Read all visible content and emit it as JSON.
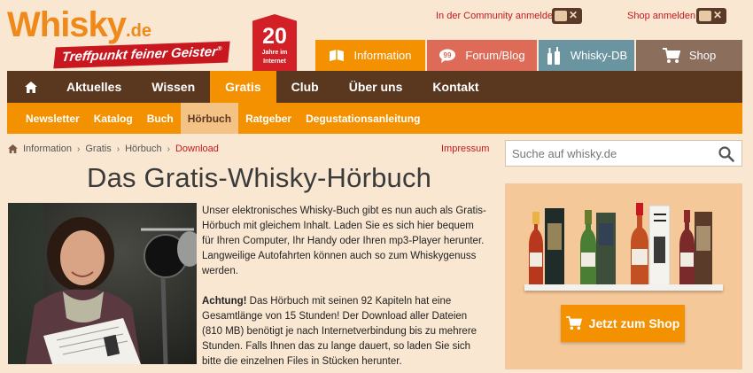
{
  "header": {
    "logo_name": "Whisky",
    "logo_tld": ".de",
    "logo_tagline": "Treffpunkt feiner Geister",
    "badge_number": "20",
    "badge_line1": "Jahre im",
    "badge_line2": "Internet",
    "community_login": "In der Community anmelden",
    "shop_login": "Shop anmelden"
  },
  "service_tabs": [
    {
      "label": "Information",
      "icon": "book-icon",
      "color": "#f39100"
    },
    {
      "label": "Forum/Blog",
      "icon": "speech-bubble-icon",
      "color": "#de6b57"
    },
    {
      "label": "Whisky-DB",
      "icon": "bottles-icon",
      "color": "#6a95a0"
    },
    {
      "label": "Shop",
      "icon": "cart-icon",
      "color": "#8c6e5c"
    }
  ],
  "main_nav": [
    "Aktuelles",
    "Wissen",
    "Gratis",
    "Club",
    "Über uns",
    "Kontakt"
  ],
  "sub_nav": [
    "Newsletter",
    "Katalog",
    "Buch",
    "Hörbuch",
    "Ratgeber",
    "Degustationsanleitung"
  ],
  "breadcrumb": [
    "Information",
    "Gratis",
    "Hörbuch",
    "Download"
  ],
  "impressum": "Impressum",
  "search": {
    "placeholder": "Suche auf whisky.de"
  },
  "page_title": "Das Gratis-Whisky-Hörbuch",
  "body": {
    "p1": "Unser elektronisches Whisky-Buch gibt es nun auch als Gratis-Hörbuch mit gleichem Inhalt. Laden Sie es sich hier bequem für Ihren Computer, Ihr Handy oder Ihren mp3-Player herunter. Langweilige Autofahrten können auch so zum Whiskygenuss werden.",
    "p2_bold": "Achtung!",
    "p2_rest": " Das Hörbuch mit seinen 92 Kapiteln hat eine Gesamtlänge von 15 Stunden! Der Download aller Dateien (810 MB) benötigt je nach Internetverbindung bis zu mehrere Stunden. Falls Ihnen das zu lange dauert, so laden Sie sich bitte die einzelnen Files in Stücken herunter."
  },
  "shop_promo": {
    "button_label": "Jetzt zum Shop"
  },
  "colors": {
    "accent_orange": "#f39100",
    "nav_brown": "#5a3820",
    "brand_red": "#c8171e",
    "page_bg": "#f9e7d1"
  }
}
